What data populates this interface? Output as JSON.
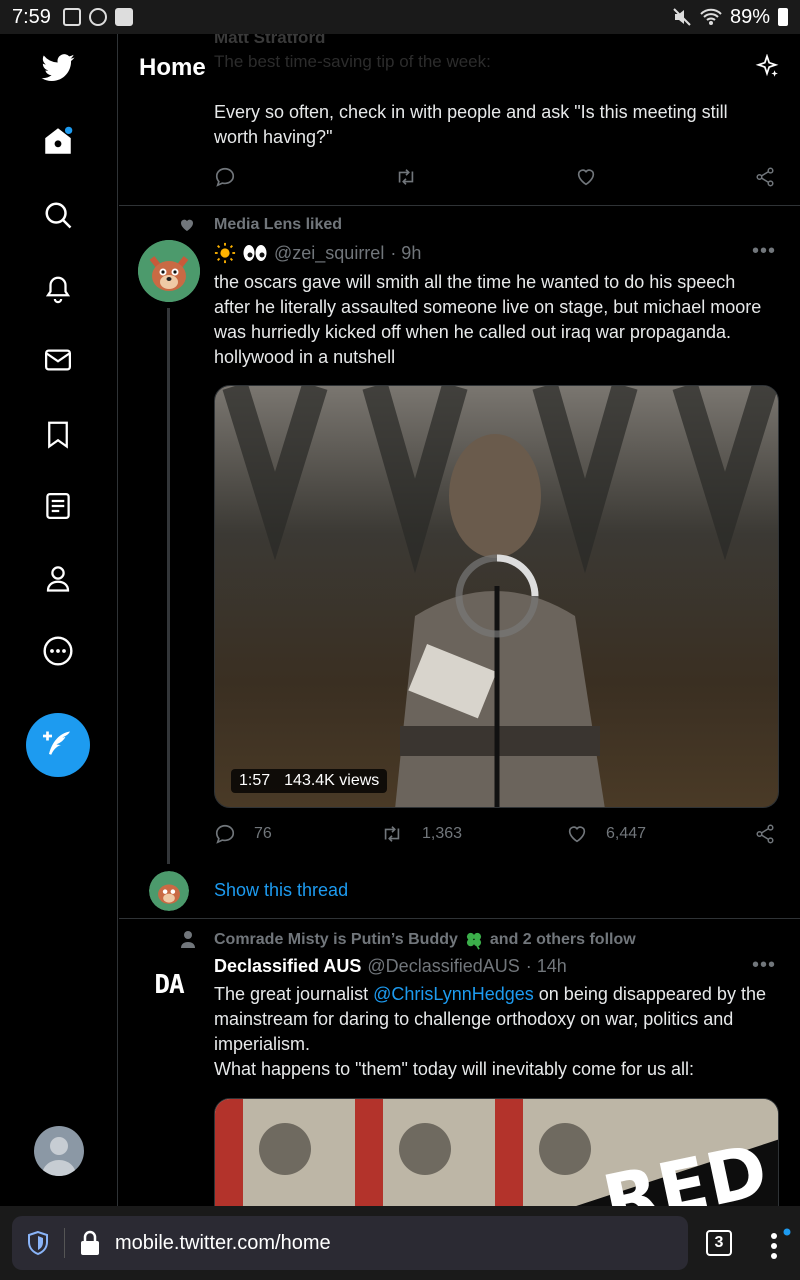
{
  "status_bar": {
    "time": "7:59",
    "battery": "89%"
  },
  "header": {
    "title": "Home"
  },
  "faded_tweet": {
    "author": "Matt Stratford",
    "text_partial": "The best time-saving tip of the week:"
  },
  "tweet1": {
    "text": "Every so often, check in with people and ask \"Is this meeting still worth having?\""
  },
  "tweet2": {
    "social_context": "Media Lens liked",
    "handle": "@zei_squirrel",
    "time": "· 9h",
    "text": "the oscars gave will smith all the time he wanted to do his speech after he literally assaulted someone live on stage, but michael moore was hurriedly kicked off when he called out iraq war propaganda. hollywood in a nutshell",
    "video_duration": "1:57",
    "video_views": "143.4K views",
    "replies": "76",
    "retweets": "1,363",
    "likes": "6,447",
    "show_thread": "Show this thread"
  },
  "tweet3": {
    "social_context_name": "Comrade Misty is Putin’s Buddy",
    "social_context_rest": "and 2 others follow",
    "display_name": "Declassified AUS",
    "handle": "@DeclassifiedAUS",
    "time": "· 14h",
    "text_before": "The great journalist ",
    "mention": "@ChrisLynnHedges",
    "text_after": " on being disappeared by the mainstream for daring to challenge orthodoxy on war, politics and imperialism.",
    "text_line2": "What happens to \"them\" today will inevitably come for us all:",
    "avatar_text": "DA",
    "media_text": "RED"
  },
  "browser": {
    "url": "mobile.twitter.com/home",
    "tab_count": "3"
  },
  "colors": {
    "accent": "#1d9bf0",
    "background": "#000000",
    "muted": "#71767b"
  }
}
